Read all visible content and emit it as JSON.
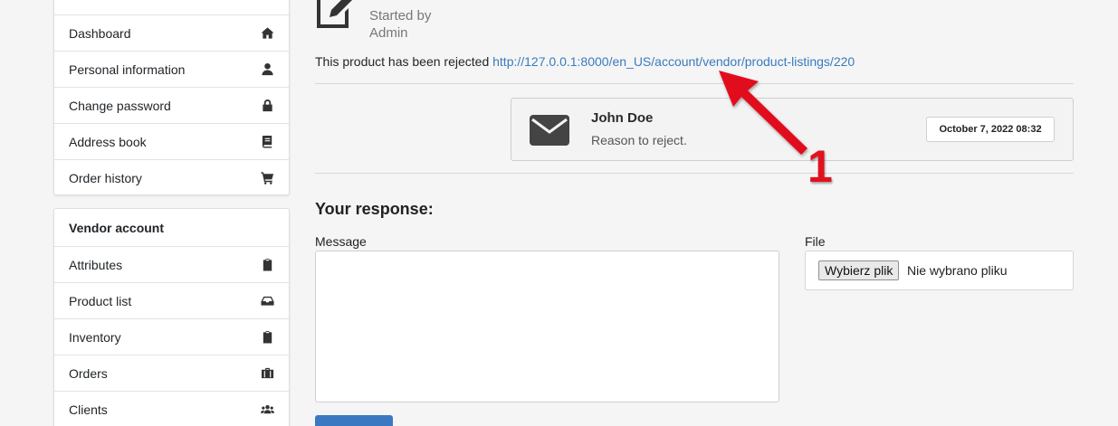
{
  "sidebar": {
    "account_items": [
      {
        "label": "Dashboard",
        "icon": "home-icon"
      },
      {
        "label": "Personal information",
        "icon": "user-icon"
      },
      {
        "label": "Change password",
        "icon": "lock-icon"
      },
      {
        "label": "Address book",
        "icon": "book-icon"
      },
      {
        "label": "Order history",
        "icon": "cart-icon"
      }
    ],
    "vendor_title": "Vendor account",
    "vendor_items": [
      {
        "label": "Attributes",
        "icon": "clipboard-icon"
      },
      {
        "label": "Product list",
        "icon": "inbox-icon"
      },
      {
        "label": "Inventory",
        "icon": "clipboard-icon"
      },
      {
        "label": "Orders",
        "icon": "briefcase-icon"
      },
      {
        "label": "Clients",
        "icon": "users-icon"
      }
    ]
  },
  "header": {
    "started_by": "Started by",
    "started_by_user": "Admin"
  },
  "notice": {
    "text": "This product has been rejected",
    "link": "http://127.0.0.1:8000/en_US/account/vendor/product-listings/220"
  },
  "message": {
    "author": "John Doe",
    "text": "Reason to reject.",
    "date": "October 7, 2022 08:32"
  },
  "annotation": {
    "number": "1",
    "color": "#e1111d"
  },
  "response": {
    "title": "Your response:",
    "message_label": "Message",
    "file_label": "File",
    "file_button": "Wybierz plik",
    "file_status": "Nie wybrano pliku"
  },
  "colors": {
    "link": "#3a7bbf",
    "primary": "#3a78c2"
  }
}
